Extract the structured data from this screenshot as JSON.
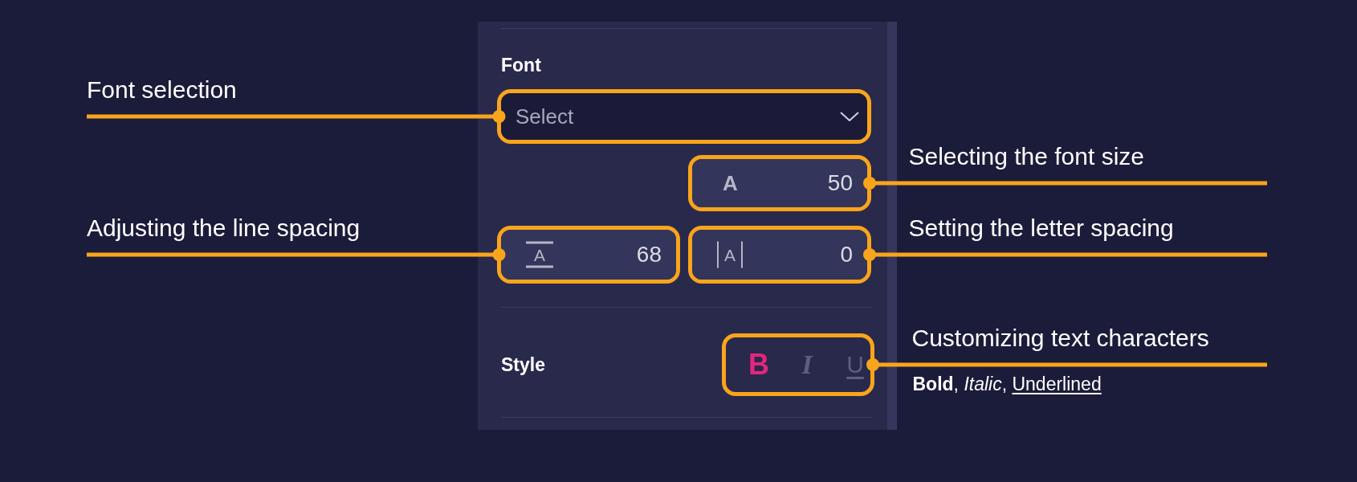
{
  "panel": {
    "font_heading": "Font",
    "font_select": {
      "placeholder": "Select",
      "callout": {
        "kind": "left",
        "text": "Font selection"
      }
    },
    "font_size": {
      "glyph": "A",
      "value": "50",
      "callout": {
        "kind": "right",
        "text": "Selecting the font size"
      }
    },
    "line_spacing": {
      "glyph": "A",
      "value": "68",
      "callout": {
        "kind": "left",
        "text": "Adjusting the line spacing"
      }
    },
    "letter_spacing": {
      "glyph": "A",
      "value": "0",
      "callout": {
        "kind": "right",
        "text": "Setting the letter spacing"
      }
    },
    "style_heading": "Style",
    "style_buttons": {
      "items": [
        {
          "kind": "bold",
          "label": "B",
          "selected": true
        },
        {
          "kind": "italic",
          "label": "I",
          "selected": false
        },
        {
          "kind": "underline",
          "label": "U",
          "selected": false
        }
      ],
      "callout": {
        "kind": "right",
        "text": "Customizing text characters",
        "note": {
          "text": "**Bold**, *Italic*, ",
          "underlined_text": "Underlined"
        }
      }
    }
  }
}
